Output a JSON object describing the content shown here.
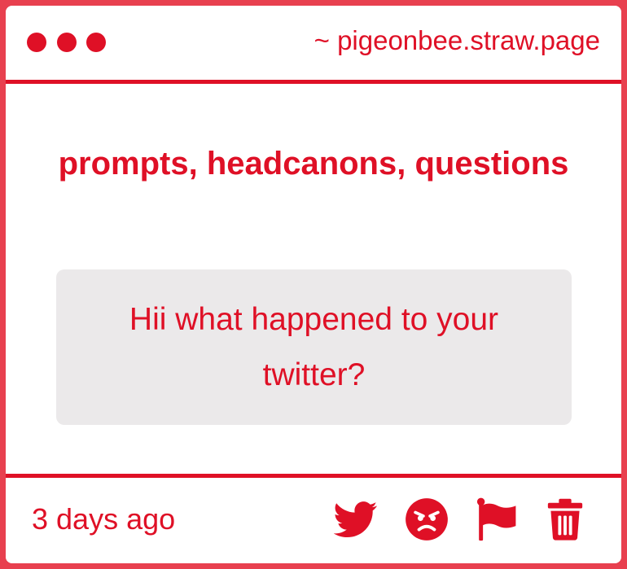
{
  "window": {
    "url": "~ pigeonbee.straw.page"
  },
  "main": {
    "heading": "prompts, headcanons, questions",
    "question": "Hii what happened to your twitter?"
  },
  "footer": {
    "timestamp": "3 days ago",
    "actions": [
      {
        "icon": "twitter-icon",
        "label": "share on twitter"
      },
      {
        "icon": "angry-face-icon",
        "label": "react"
      },
      {
        "icon": "flag-icon",
        "label": "report"
      },
      {
        "icon": "trash-icon",
        "label": "delete"
      }
    ]
  },
  "colors": {
    "accent": "#df1026",
    "border": "#e8404f",
    "question_bg": "#ebe9ea"
  }
}
